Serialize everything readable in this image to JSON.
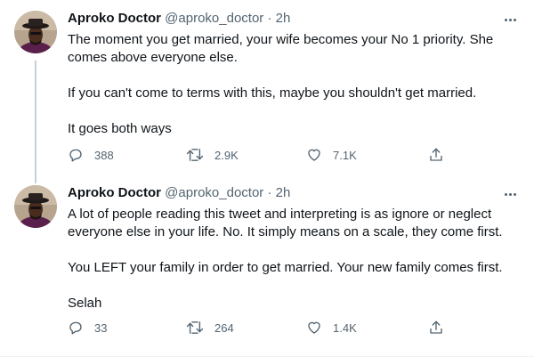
{
  "tweets": [
    {
      "author_name": "Aproko Doctor",
      "handle": "@aproko_doctor",
      "separator": "·",
      "time": "2h",
      "paragraphs": [
        "The moment you get married, your wife becomes your No 1 priority. She comes above everyone else.",
        "If you can't come to terms with this, maybe you shouldn't get married.",
        "It goes both ways"
      ],
      "replies": "388",
      "retweets": "2.9K",
      "likes": "7.1K"
    },
    {
      "author_name": "Aproko Doctor",
      "handle": "@aproko_doctor",
      "separator": "·",
      "time": "2h",
      "paragraphs": [
        "A lot of people reading this tweet and interpreting is as ignore or neglect everyone else in your life. No. It simply means on a scale, they come first.",
        "You LEFT your family in order to get married. Your new family comes first.",
        "Selah"
      ],
      "replies": "33",
      "retweets": "264",
      "likes": "1.4K"
    }
  ],
  "icons": {
    "reply": "reply-icon",
    "retweet": "retweet-icon",
    "like": "heart-icon",
    "share": "share-icon",
    "more": "more-icon"
  },
  "colors": {
    "text": "#0f1419",
    "secondary": "#536471",
    "thread_line": "#c4cfd6"
  }
}
